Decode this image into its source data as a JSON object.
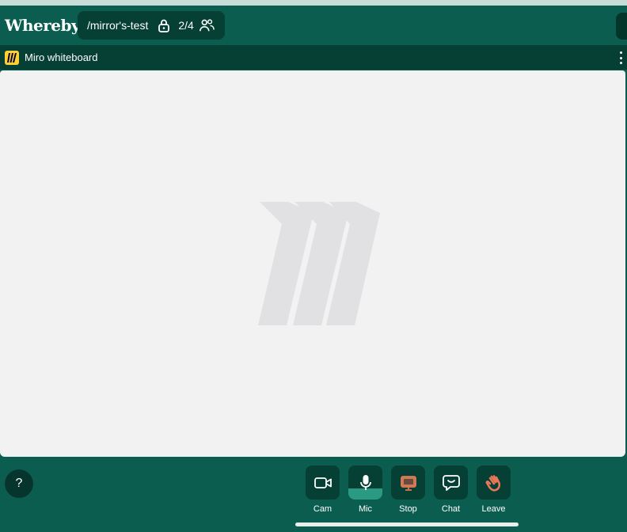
{
  "app": {
    "logo_text": "Whereby"
  },
  "room": {
    "name": "/mirror's-test",
    "participant_count": "2/4",
    "icons": [
      "lock-icon",
      "people-icon"
    ]
  },
  "whiteboard": {
    "title": "Miro whiteboard",
    "logo_color": "#ffd02f"
  },
  "help": {
    "label": "?"
  },
  "controls": [
    {
      "id": "cam",
      "label": "Cam",
      "icon": "camera-icon"
    },
    {
      "id": "mic",
      "label": "Mic",
      "icon": "microphone-icon",
      "active": true
    },
    {
      "id": "stop",
      "label": "Stop",
      "icon": "screen-share-icon"
    },
    {
      "id": "chat",
      "label": "Chat",
      "icon": "chat-icon"
    },
    {
      "id": "leave",
      "label": "Leave",
      "icon": "waving-hand-icon"
    }
  ],
  "colors": {
    "background": "#0b5e4f",
    "panel": "#063f34",
    "canvas": "#f2f2f2",
    "mic_active": "#2a9a82",
    "stop_accent": "#e07a50",
    "leave_accent": "#e8765a"
  }
}
